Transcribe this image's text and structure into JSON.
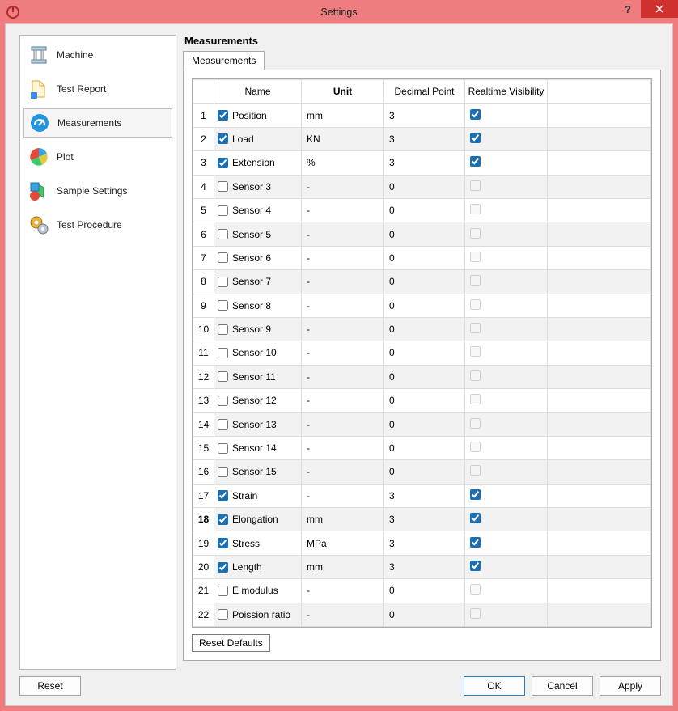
{
  "window": {
    "title": "Settings"
  },
  "sidebar": {
    "items": [
      {
        "label": "Machine"
      },
      {
        "label": "Test Report"
      },
      {
        "label": "Measurements",
        "selected": true
      },
      {
        "label": "Plot"
      },
      {
        "label": "Sample Settings"
      },
      {
        "label": "Test Procedure"
      }
    ]
  },
  "main": {
    "title": "Measurements",
    "tab": "Measurements",
    "headers": {
      "name": "Name",
      "unit": "Unit",
      "decimal": "Decimal Point",
      "realtime": "Realtime Visibility"
    },
    "rows": [
      {
        "idx": "1",
        "enabled": true,
        "name": "Position",
        "unit": "mm",
        "decimal": "3",
        "rt": true,
        "rt_enabled": true
      },
      {
        "idx": "2",
        "enabled": true,
        "name": "Load",
        "unit": "KN",
        "decimal": "3",
        "rt": true,
        "rt_enabled": true
      },
      {
        "idx": "3",
        "enabled": true,
        "name": "Extension",
        "unit": "%",
        "decimal": "3",
        "rt": true,
        "rt_enabled": true
      },
      {
        "idx": "4",
        "enabled": false,
        "name": "Sensor 3",
        "unit": "-",
        "decimal": "0",
        "rt": false,
        "rt_enabled": false
      },
      {
        "idx": "5",
        "enabled": false,
        "name": "Sensor 4",
        "unit": "-",
        "decimal": "0",
        "rt": false,
        "rt_enabled": false
      },
      {
        "idx": "6",
        "enabled": false,
        "name": "Sensor 5",
        "unit": "-",
        "decimal": "0",
        "rt": false,
        "rt_enabled": false
      },
      {
        "idx": "7",
        "enabled": false,
        "name": "Sensor 6",
        "unit": "-",
        "decimal": "0",
        "rt": false,
        "rt_enabled": false
      },
      {
        "idx": "8",
        "enabled": false,
        "name": "Sensor 7",
        "unit": "-",
        "decimal": "0",
        "rt": false,
        "rt_enabled": false
      },
      {
        "idx": "9",
        "enabled": false,
        "name": "Sensor 8",
        "unit": "-",
        "decimal": "0",
        "rt": false,
        "rt_enabled": false
      },
      {
        "idx": "10",
        "enabled": false,
        "name": "Sensor 9",
        "unit": "-",
        "decimal": "0",
        "rt": false,
        "rt_enabled": false
      },
      {
        "idx": "11",
        "enabled": false,
        "name": "Sensor 10",
        "unit": "-",
        "decimal": "0",
        "rt": false,
        "rt_enabled": false
      },
      {
        "idx": "12",
        "enabled": false,
        "name": "Sensor 11",
        "unit": "-",
        "decimal": "0",
        "rt": false,
        "rt_enabled": false
      },
      {
        "idx": "13",
        "enabled": false,
        "name": "Sensor 12",
        "unit": "-",
        "decimal": "0",
        "rt": false,
        "rt_enabled": false
      },
      {
        "idx": "14",
        "enabled": false,
        "name": "Sensor 13",
        "unit": "-",
        "decimal": "0",
        "rt": false,
        "rt_enabled": false
      },
      {
        "idx": "15",
        "enabled": false,
        "name": "Sensor 14",
        "unit": "-",
        "decimal": "0",
        "rt": false,
        "rt_enabled": false
      },
      {
        "idx": "16",
        "enabled": false,
        "name": "Sensor 15",
        "unit": "-",
        "decimal": "0",
        "rt": false,
        "rt_enabled": false
      },
      {
        "idx": "17",
        "enabled": true,
        "name": "Strain",
        "unit": "-",
        "decimal": "3",
        "rt": true,
        "rt_enabled": true
      },
      {
        "idx": "18",
        "enabled": true,
        "name": "Elongation",
        "unit": "mm",
        "decimal": "3",
        "rt": true,
        "rt_enabled": true,
        "selected": true
      },
      {
        "idx": "19",
        "enabled": true,
        "name": "Stress",
        "unit": "MPa",
        "decimal": "3",
        "rt": true,
        "rt_enabled": true
      },
      {
        "idx": "20",
        "enabled": true,
        "name": "Length",
        "unit": "mm",
        "decimal": "3",
        "rt": true,
        "rt_enabled": true
      },
      {
        "idx": "21",
        "enabled": false,
        "name": "E modulus",
        "unit": "-",
        "decimal": "0",
        "rt": false,
        "rt_enabled": false
      },
      {
        "idx": "22",
        "enabled": false,
        "name": "Poission ratio",
        "unit": "-",
        "decimal": "0",
        "rt": false,
        "rt_enabled": false
      }
    ],
    "reset_defaults": "Reset Defaults"
  },
  "buttons": {
    "reset": "Reset",
    "ok": "OK",
    "cancel": "Cancel",
    "apply": "Apply"
  }
}
